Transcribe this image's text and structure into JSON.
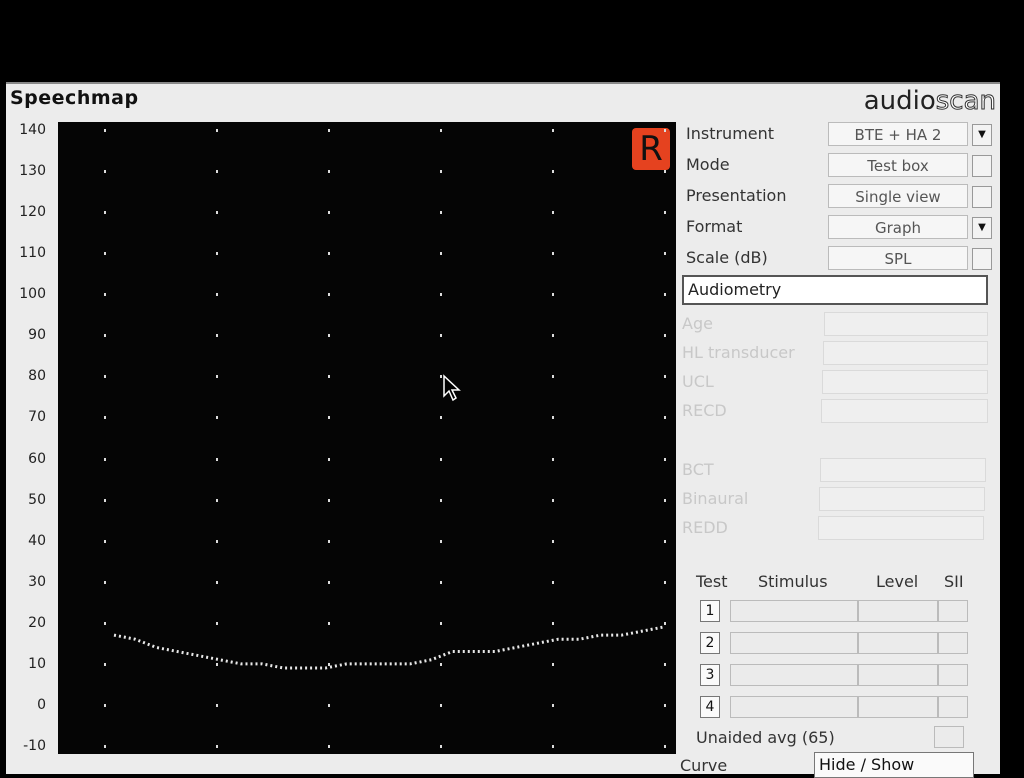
{
  "window": {
    "title": "Speechmap"
  },
  "brand": {
    "part1": "audio",
    "part2": "scan"
  },
  "chart": {
    "y_ticks": [
      "140",
      "130",
      "120",
      "110",
      "100",
      "90",
      "80",
      "70",
      "60",
      "50",
      "40",
      "30",
      "20",
      "10",
      "0",
      "-10"
    ],
    "ear_label": "R"
  },
  "chart_data": {
    "type": "line",
    "ylim": [
      -10,
      140
    ],
    "y_ticks": [
      140,
      130,
      120,
      110,
      100,
      90,
      80,
      70,
      60,
      50,
      40,
      30,
      20,
      10,
      0,
      -10
    ],
    "series": [
      {
        "values": [
          17,
          16,
          14,
          13,
          12,
          11,
          10,
          10,
          9,
          9,
          9,
          10,
          10,
          10,
          10,
          11,
          13,
          13,
          13,
          14,
          15,
          16,
          16,
          17,
          17,
          18,
          19
        ]
      }
    ]
  },
  "settings": {
    "rows": [
      {
        "label": "Instrument",
        "value": "BTE + HA 2",
        "dropdown": true
      },
      {
        "label": "Mode",
        "value": "Test box",
        "dropdown": false
      },
      {
        "label": "Presentation",
        "value": "Single view",
        "dropdown": false
      },
      {
        "label": "Format",
        "value": "Graph",
        "dropdown": true
      },
      {
        "label": "Scale (dB)",
        "value": "SPL",
        "dropdown": false
      }
    ]
  },
  "audiometry": {
    "header": "Audiometry",
    "fields": [
      "Age",
      "HL transducer",
      "UCL",
      "RECD",
      "BCT",
      "Binaural",
      "REDD"
    ]
  },
  "tests": {
    "headers": {
      "test": "Test",
      "stimulus": "Stimulus",
      "level": "Level",
      "sii": "SII"
    },
    "rows": [
      "1",
      "2",
      "3",
      "4"
    ],
    "unaided": "Unaided avg (65)",
    "curve": "Curve",
    "hide_show": "Hide / Show"
  },
  "colors": {
    "ear_badge": "#e5421f",
    "plot_bg": "#050505",
    "curve": "#e8e8e8"
  }
}
